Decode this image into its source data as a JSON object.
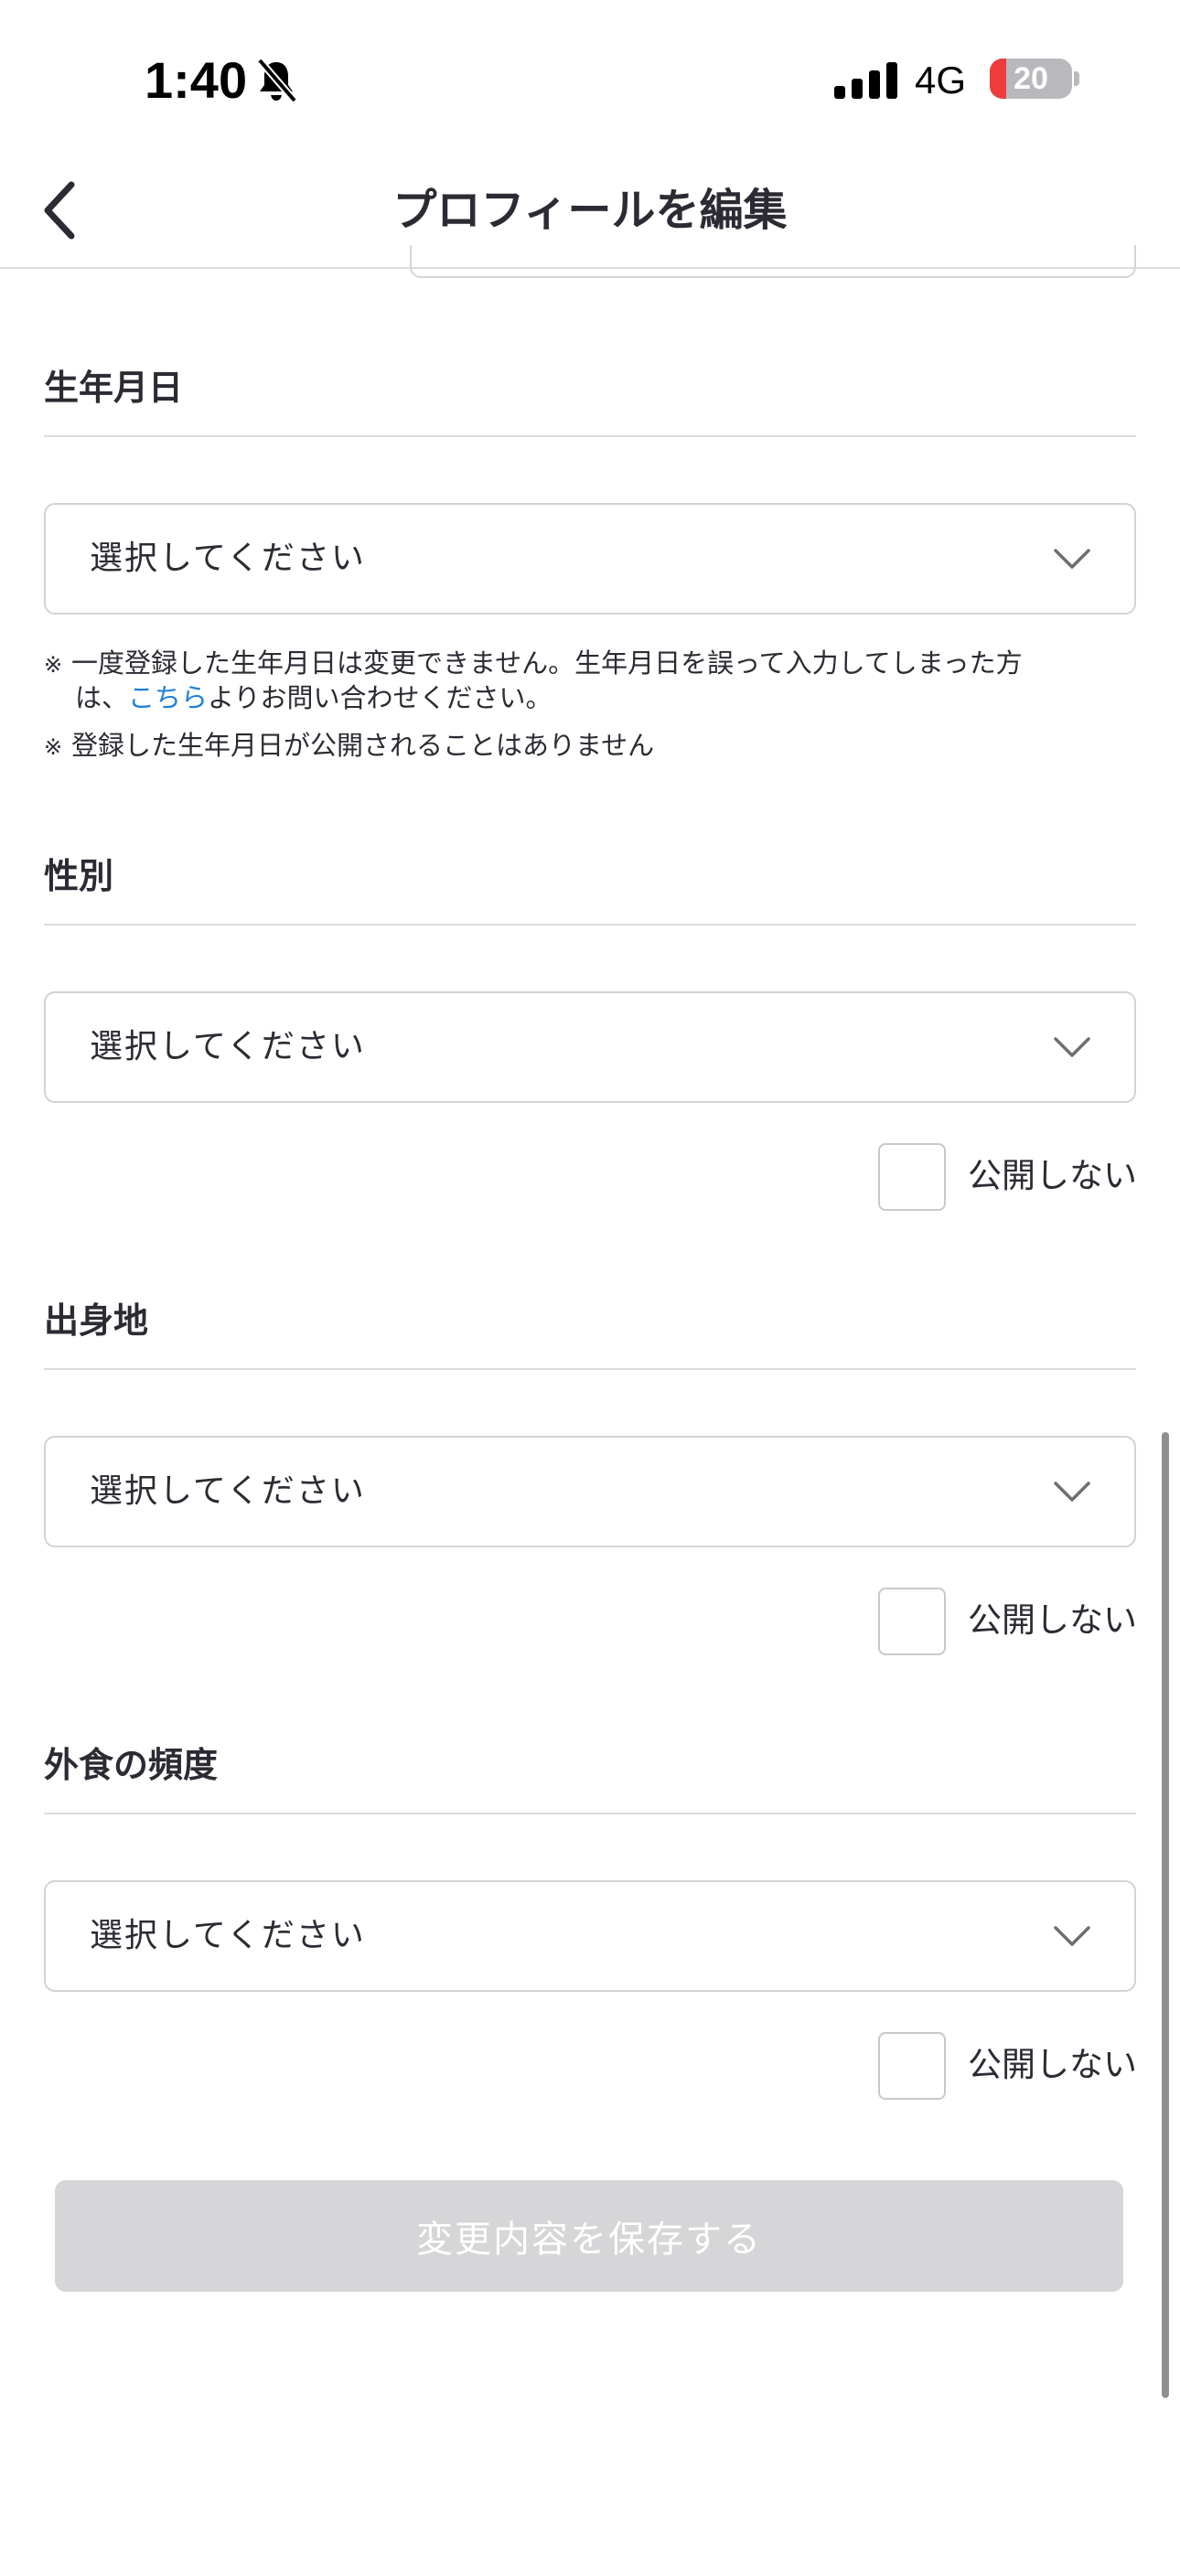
{
  "status_bar": {
    "time": "1:40",
    "network": "4G",
    "battery_level": "20",
    "battery_fraction": 0.2,
    "icons": [
      "bell-slash-icon",
      "signal-bars-icon",
      "battery-icon"
    ]
  },
  "header": {
    "back_icon": "chevron-left-icon",
    "title": "プロフィールを編集"
  },
  "colors": {
    "link": "#1f7fd6",
    "battery_low": "#ef3c3c",
    "button_disabled": "#d6d6d8"
  },
  "sections": {
    "birthday": {
      "title": "生年月日",
      "select_value": "選択してください",
      "note_mark": "※",
      "note1_part1": "一度登録した生年月日は変更できません。生年月日を誤って入力してしまった方",
      "note1_part2": "は、",
      "note1_link": "こちら",
      "note1_part3": "よりお問い合わせください。",
      "note2": "登録した生年月日が公開されることはありません"
    },
    "gender": {
      "title": "性別",
      "select_value": "選択してください",
      "private_label": "公開しない",
      "private_checked": false
    },
    "hometown": {
      "title": "出身地",
      "select_value": "選択してください",
      "private_label": "公開しない",
      "private_checked": false
    },
    "dining_frequency": {
      "title": "外食の頻度",
      "select_value": "選択してください",
      "private_label": "公開しない",
      "private_checked": false
    }
  },
  "save_button": {
    "label": "変更内容を保存する",
    "enabled": false
  }
}
